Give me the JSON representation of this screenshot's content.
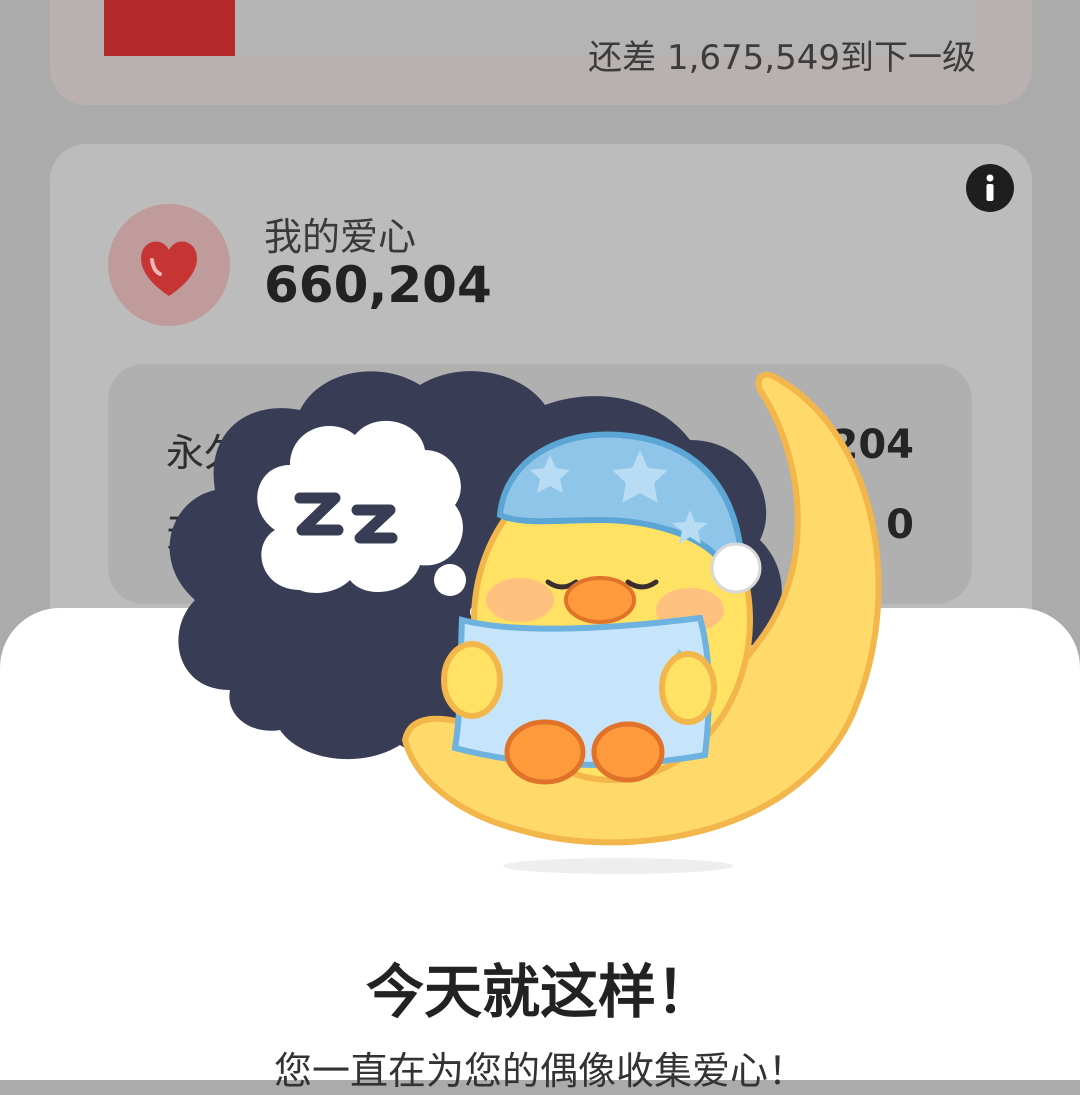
{
  "level_card": {
    "progress_fraction": 0.15,
    "remaining_text": "还差 1,675,549到下一级"
  },
  "hearts_card": {
    "label": "我的爱心",
    "value": "660,204",
    "breakdown": [
      {
        "label": "永久爱",
        "value": "204"
      },
      {
        "label": "天",
        "value": "0"
      }
    ]
  },
  "sheet": {
    "title": "今天就这样！",
    "subtitle": "您一直在为您的偶像收集爱心！"
  },
  "icons": [
    "info-icon",
    "heart-icon",
    "sleeping-duck-illustration",
    "zzz-icon"
  ],
  "colors": {
    "accent_red": "#d33b3b",
    "moon_yellow": "#ffd96a",
    "cloud_navy": "#383d55"
  }
}
